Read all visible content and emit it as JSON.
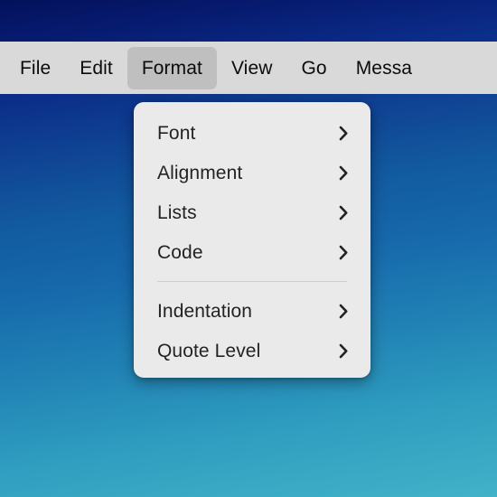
{
  "desktop": {
    "wallpaper_top_color": "#04115c",
    "wallpaper_bottom_color": "#41b2c8"
  },
  "menubar": {
    "background_color": "#d9d9d9",
    "active_highlight_color": "#bfbfbf",
    "items": [
      {
        "label": "File",
        "active": false
      },
      {
        "label": "Edit",
        "active": false
      },
      {
        "label": "Format",
        "active": true
      },
      {
        "label": "View",
        "active": false
      },
      {
        "label": "Go",
        "active": false
      },
      {
        "label": "Messa",
        "active": false
      }
    ]
  },
  "dropdown": {
    "owner": "Format",
    "background_color": "#eaeaea",
    "groups": [
      {
        "items": [
          {
            "label": "Font",
            "submenu_icon": "chevron-right-icon"
          },
          {
            "label": "Alignment",
            "submenu_icon": "chevron-right-icon"
          },
          {
            "label": "Lists",
            "submenu_icon": "chevron-right-icon"
          },
          {
            "label": "Code",
            "submenu_icon": "chevron-right-icon"
          }
        ]
      },
      {
        "items": [
          {
            "label": "Indentation",
            "submenu_icon": "chevron-right-icon"
          },
          {
            "label": "Quote Level",
            "submenu_icon": "chevron-right-icon"
          }
        ]
      }
    ]
  }
}
